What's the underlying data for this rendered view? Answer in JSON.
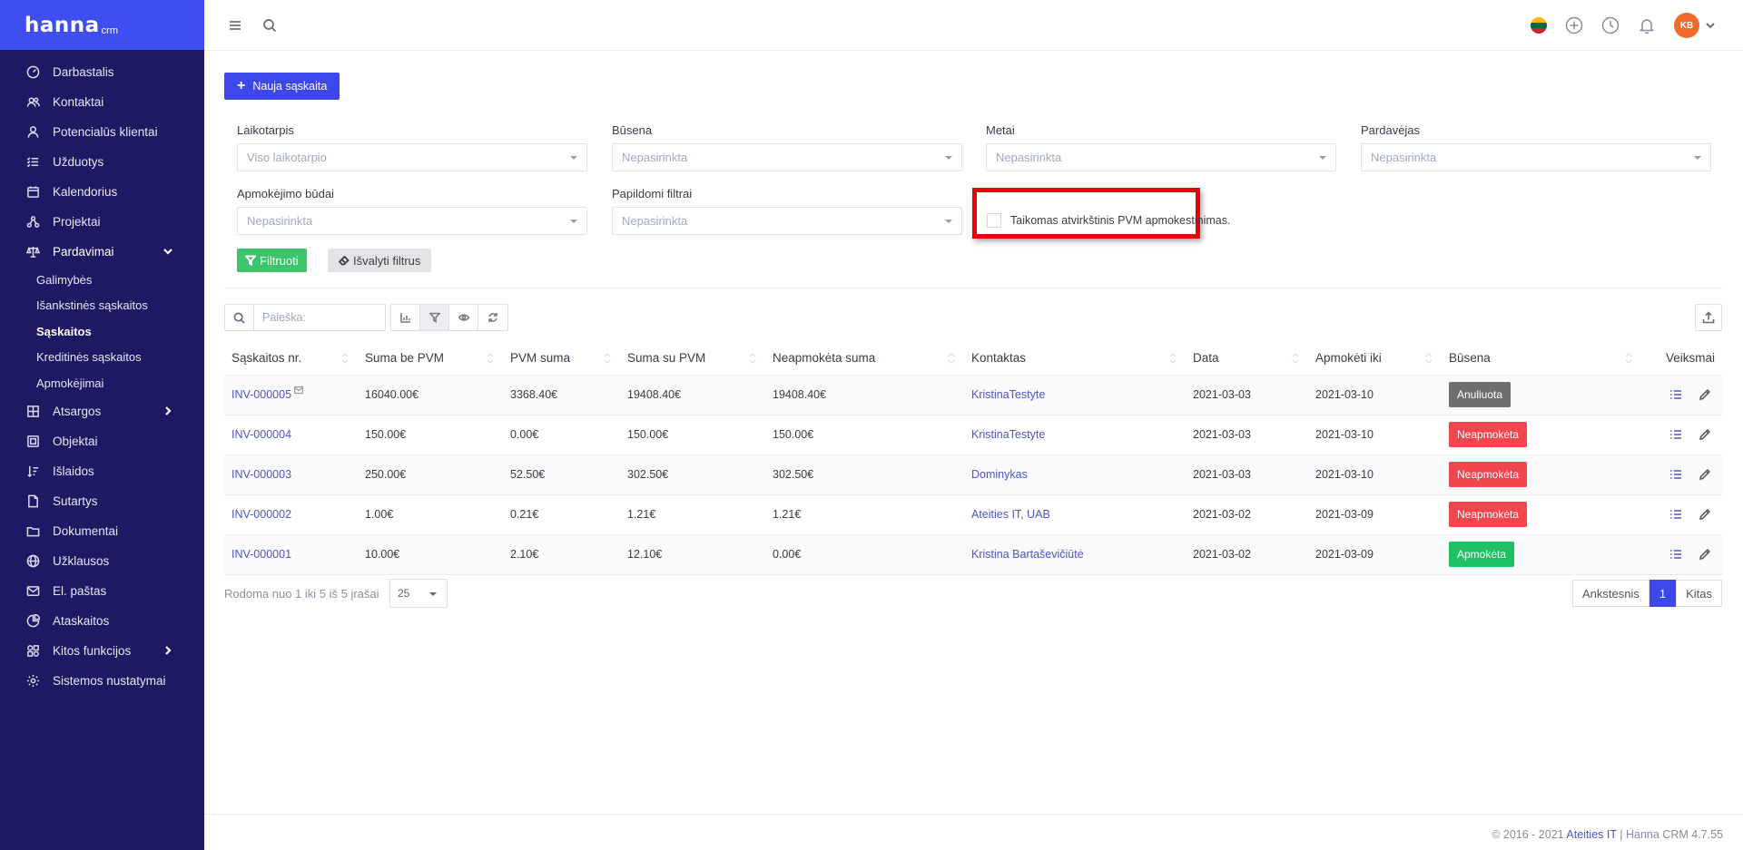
{
  "brand": {
    "name": "hanna",
    "sub": "crm"
  },
  "sidebar": {
    "items": [
      {
        "label": "Darbastalis",
        "icon": "dashboard-icon"
      },
      {
        "label": "Kontaktai",
        "icon": "users-icon"
      },
      {
        "label": "Potencialūs klientai",
        "icon": "lead-icon"
      },
      {
        "label": "Užduotys",
        "icon": "tasks-icon"
      },
      {
        "label": "Kalendorius",
        "icon": "calendar-icon"
      },
      {
        "label": "Projektai",
        "icon": "projects-icon"
      },
      {
        "label": "Pardavimai",
        "icon": "scale-icon"
      }
    ],
    "sales_sub": [
      "Galimybės",
      "Išankstinės sąskaitos",
      "Sąskaitos",
      "Kreditinės sąskaitos",
      "Apmokėjimai"
    ],
    "items_after": [
      {
        "label": "Atsargos",
        "icon": "stock-icon"
      },
      {
        "label": "Objektai",
        "icon": "objects-icon"
      },
      {
        "label": "Išlaidos",
        "icon": "expenses-icon"
      },
      {
        "label": "Sutartys",
        "icon": "contract-icon"
      },
      {
        "label": "Dokumentai",
        "icon": "folder-icon"
      },
      {
        "label": "Užklausos",
        "icon": "globe-icon"
      },
      {
        "label": "El. paštas",
        "icon": "mail-icon"
      },
      {
        "label": "Ataskaitos",
        "icon": "report-icon"
      },
      {
        "label": "Kitos funkcijos",
        "icon": "functions-icon"
      },
      {
        "label": "Sistemos nustatymai",
        "icon": "gear-icon"
      }
    ]
  },
  "topbar": {
    "avatar_initials": "KB"
  },
  "actions": {
    "new_invoice": "Nauja sąskaita"
  },
  "filters": {
    "period": {
      "label": "Laikotarpis",
      "value": "Viso laikotarpio"
    },
    "status": {
      "label": "Būsena",
      "value": "Nepasirinkta"
    },
    "year": {
      "label": "Metai",
      "value": "Nepasirinkta"
    },
    "seller": {
      "label": "Pardavėjas",
      "value": "Nepasirinkta"
    },
    "payment": {
      "label": "Apmokėjimo būdai",
      "value": "Nepasirinkta"
    },
    "extra": {
      "label": "Papildomi filtrai",
      "value": "Nepasirinkta"
    },
    "reverse_vat": "Taikomas atvirkštinis PVM apmokestinimas.",
    "apply": "Filtruoti",
    "clear": "Išvalyti filtrus"
  },
  "search": {
    "placeholder": "Paieška:"
  },
  "table": {
    "headers": [
      "Sąskaitos nr.",
      "Suma be PVM",
      "PVM suma",
      "Suma su PVM",
      "Neapmokėta suma",
      "Kontaktas",
      "Data",
      "Apmokėti iki",
      "Būsena",
      "Veiksmai"
    ],
    "rows": [
      {
        "nr": "INV-000005",
        "net": "16040.00€",
        "vat": "3368.40€",
        "gross": "19408.40€",
        "unpaid": "19408.40€",
        "contact": "KristinaTestyte",
        "date": "2021-03-03",
        "due": "2021-03-10",
        "status": "Anuliuota",
        "status_color": "#6f6f6f",
        "mail": true
      },
      {
        "nr": "INV-000004",
        "net": "150.00€",
        "vat": "0.00€",
        "gross": "150.00€",
        "unpaid": "150.00€",
        "contact": "KristinaTestyte",
        "date": "2021-03-03",
        "due": "2021-03-10",
        "status": "Neapmokėta",
        "status_color": "#f2464f",
        "mail": false
      },
      {
        "nr": "INV-000003",
        "net": "250.00€",
        "vat": "52.50€",
        "gross": "302.50€",
        "unpaid": "302.50€",
        "contact": "Dominykas",
        "date": "2021-03-03",
        "due": "2021-03-10",
        "status": "Neapmokėta",
        "status_color": "#f2464f",
        "mail": false
      },
      {
        "nr": "INV-000002",
        "net": "1.00€",
        "vat": "0.21€",
        "gross": "1.21€",
        "unpaid": "1.21€",
        "contact": "Ateities IT, UAB",
        "date": "2021-03-02",
        "due": "2021-03-09",
        "status": "Neapmokėta",
        "status_color": "#f2464f",
        "mail": false
      },
      {
        "nr": "INV-000001",
        "net": "10.00€",
        "vat": "2.10€",
        "gross": "12.10€",
        "unpaid": "0.00€",
        "contact": "Kristina Bartaševičiūtė",
        "date": "2021-03-02",
        "due": "2021-03-09",
        "status": "Apmokėta",
        "status_color": "#1fbf63",
        "mail": false
      }
    ]
  },
  "pagination": {
    "info": "Rodoma nuo 1 iki 5 iš 5 įrašai",
    "page_size": "25",
    "prev": "Ankstesnis",
    "current": "1",
    "next": "Kitas"
  },
  "footer": {
    "prefix": "© 2016 - 2021",
    "link": "Ateities IT",
    "suffix": "| Hanna CRM 4.7.55"
  }
}
